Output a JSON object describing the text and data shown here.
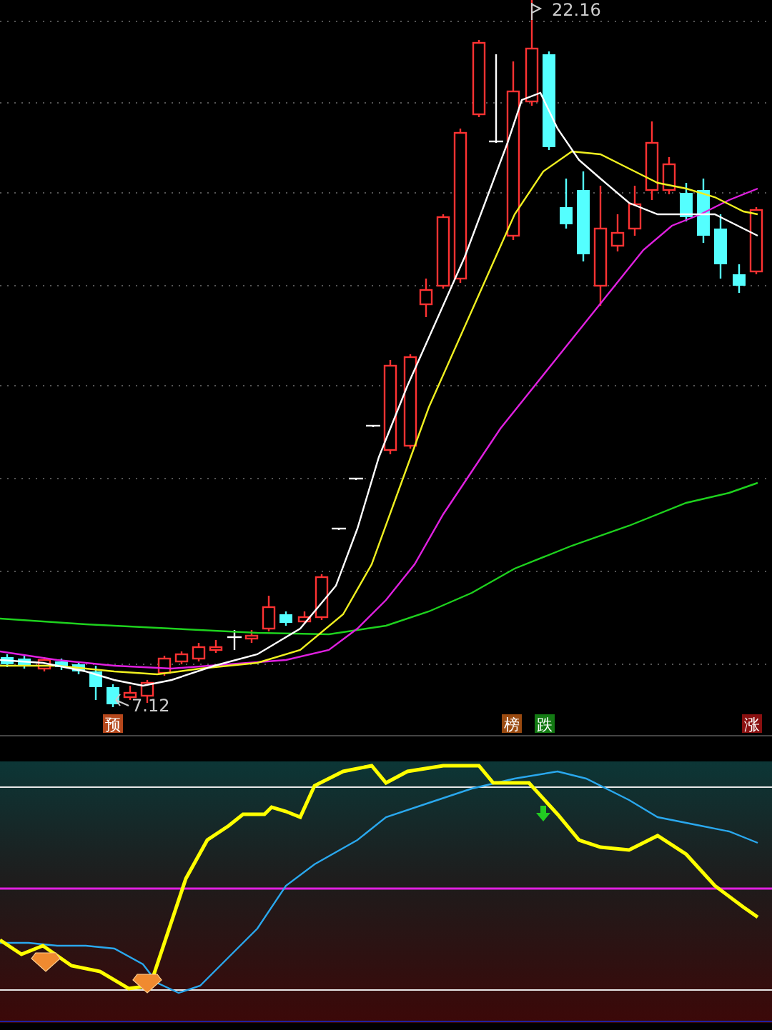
{
  "price_chart": {
    "high_label": "22.16",
    "low_label": "7.12"
  },
  "signal_badges": [
    {
      "text": "预",
      "color": "#b5471b"
    },
    {
      "text": "榜",
      "color": "#9a4a10"
    },
    {
      "text": "跌",
      "color": "#137a13"
    },
    {
      "text": "涨",
      "color": "#8a1010"
    }
  ]
}
